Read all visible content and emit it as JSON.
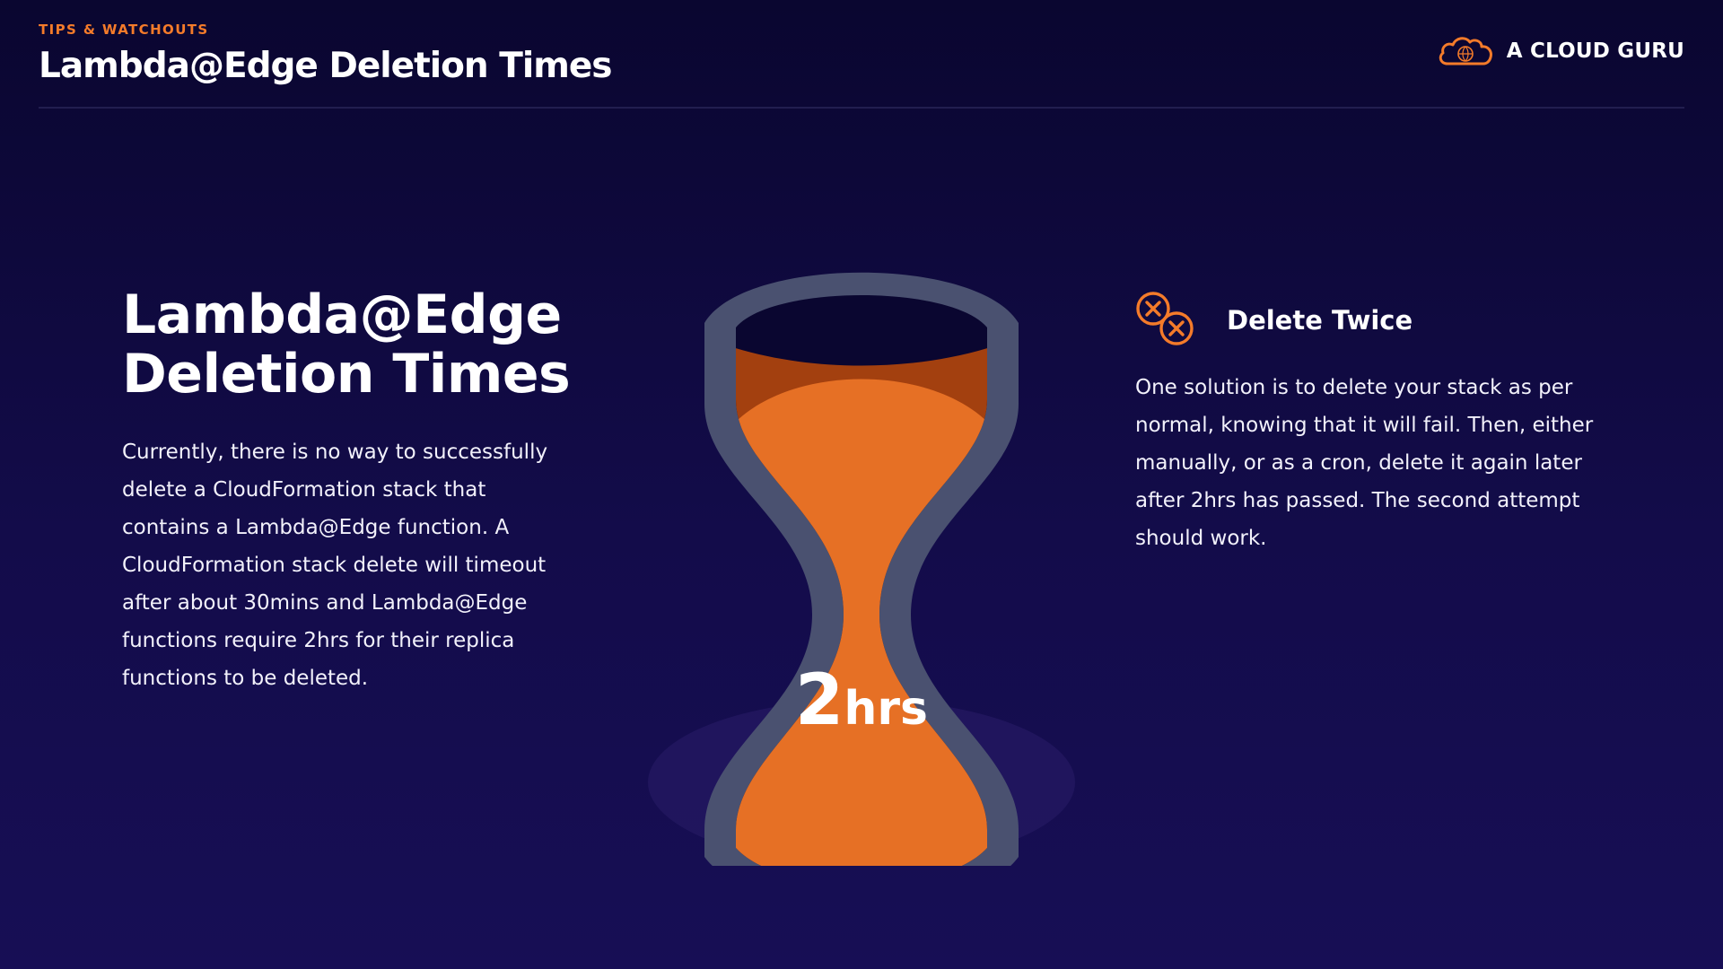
{
  "header": {
    "eyebrow": "TIPS & WATCHOUTS",
    "title": "Lambda@Edge Deletion Times"
  },
  "brand": {
    "name": "A CLOUD GURU",
    "logo_icon": "cloud-logo-icon"
  },
  "main": {
    "title_line1": "Lambda@Edge",
    "title_line2": "Deletion Times",
    "body": "Currently, there is no way to successfully delete a CloudFormation stack that contains a Lambda@Edge function. A CloudFormation stack delete will timeout after about 30mins and Lambda@Edge functions require 2hrs for their replica functions to be deleted."
  },
  "hourglass": {
    "icon": "hourglass-icon",
    "number": "2",
    "unit": "hrs"
  },
  "callout": {
    "icon": "double-x-circle-icon",
    "title": "Delete Twice",
    "body": "One solution is to delete your stack as per normal, knowing that it will fail. Then, either manually, or as a cron, delete it again later after 2hrs has passed. The second attempt should work."
  },
  "colors": {
    "accent": "#f47b2a",
    "sand": "#e67025",
    "sand_dark": "#a3400f",
    "glass_frame": "#4a5170",
    "background": "#0a0630"
  }
}
